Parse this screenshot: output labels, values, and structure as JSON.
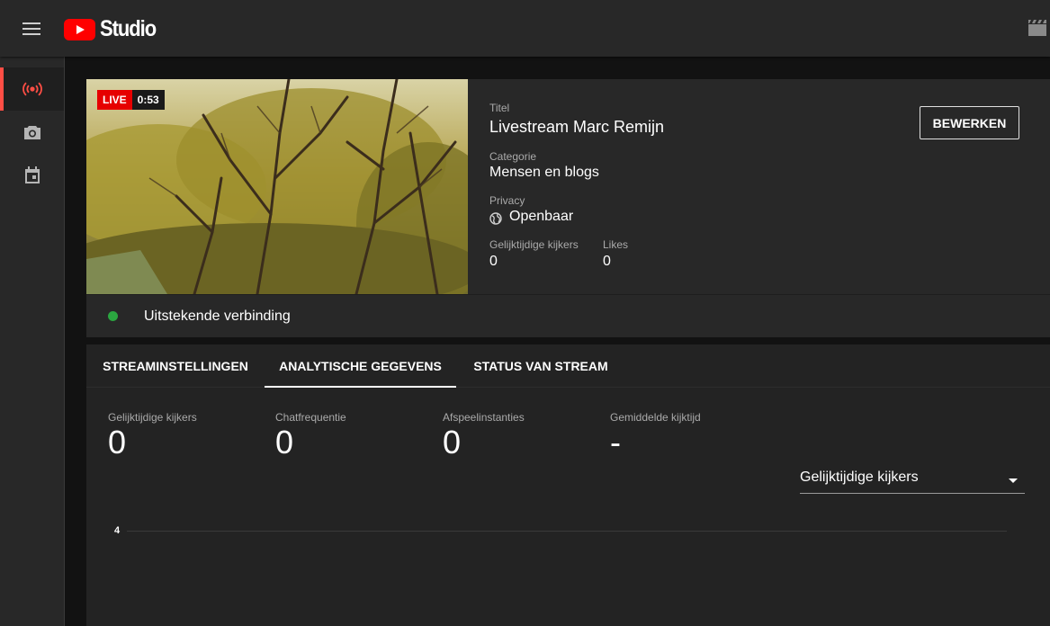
{
  "app": {
    "name": "Studio"
  },
  "colors": {
    "brand_red": "#ff0000",
    "live_red": "#e60000",
    "active_indicator": "#ff4e45",
    "status_green": "#2ba640"
  },
  "topbar": {
    "menu_icon": "hamburger-menu-icon",
    "logo_icon": "youtube-play-icon",
    "create_icon": "clapperboard-icon"
  },
  "sidebar": {
    "items": [
      {
        "icon": "live-broadcast-icon",
        "active": true
      },
      {
        "icon": "camera-icon",
        "active": false
      },
      {
        "icon": "calendar-icon",
        "active": false
      }
    ]
  },
  "stream": {
    "live_label": "LIVE",
    "elapsed": "0:53",
    "title_label": "Titel",
    "title": "Livestream Marc Remijn",
    "category_label": "Categorie",
    "category": "Mensen en blogs",
    "privacy_label": "Privacy",
    "privacy": "Openbaar",
    "privacy_icon": "globe-icon",
    "viewers_label": "Gelijktijdige kijkers",
    "viewers": "0",
    "likes_label": "Likes",
    "likes": "0",
    "edit_button": "BEWERKEN",
    "connection": "Uitstekende verbinding"
  },
  "tabs": [
    {
      "label": "STREAMINSTELLINGEN",
      "active": false
    },
    {
      "label": "ANALYTISCHE GEGEVENS",
      "active": true
    },
    {
      "label": "STATUS VAN STREAM",
      "active": false
    }
  ],
  "metrics": [
    {
      "label": "Gelijktijdige kijkers",
      "value": "0"
    },
    {
      "label": "Chatfrequentie",
      "value": "0"
    },
    {
      "label": "Afspeelinstanties",
      "value": "0"
    },
    {
      "label": "Gemiddelde kijktijd",
      "value": "-"
    }
  ],
  "chart_selector": {
    "selected": "Gelijktijdige kijkers"
  },
  "chart": {
    "y_tick": "4"
  }
}
